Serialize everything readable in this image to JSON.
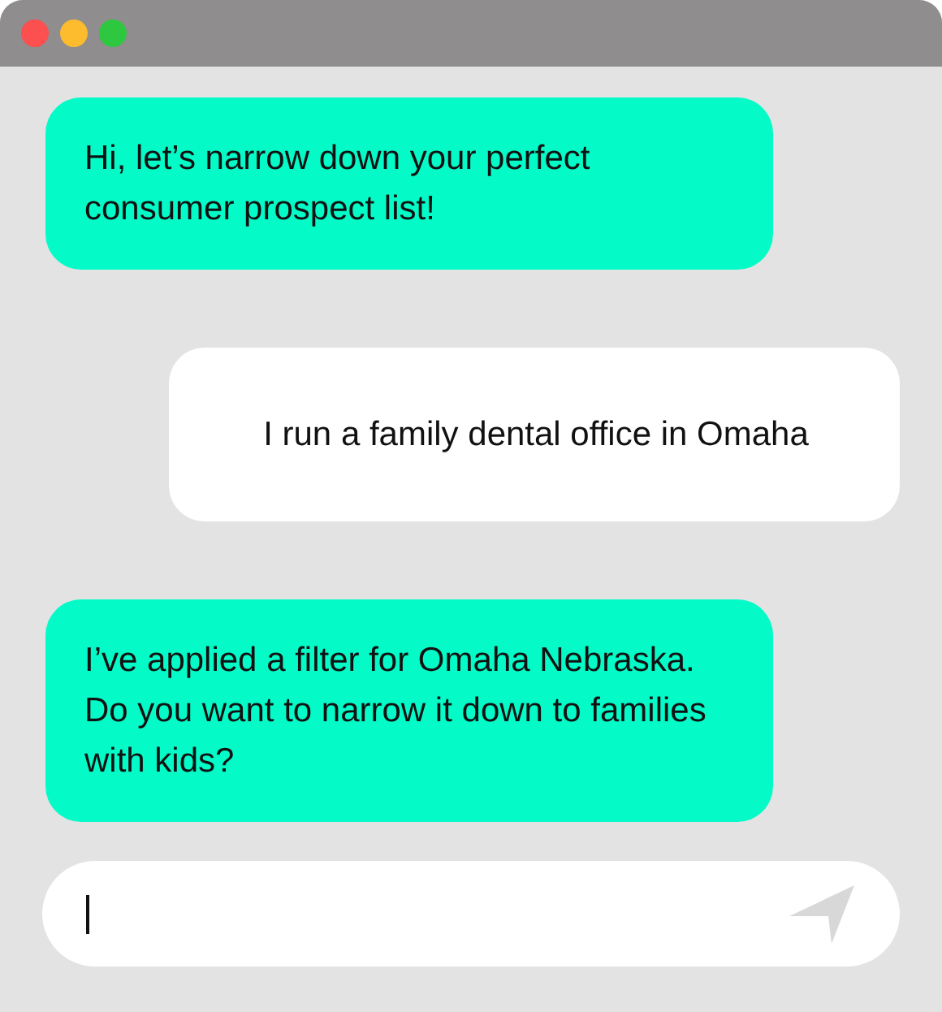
{
  "window": {
    "controls": [
      {
        "color": "#fc4f4f"
      },
      {
        "color": "#fdbb2e"
      },
      {
        "color": "#2ec840"
      }
    ]
  },
  "messages": [
    {
      "kind": "bot",
      "text": "Hi, let’s narrow down your perfect consumer prospect list!"
    },
    {
      "kind": "user",
      "text": "I run a family dental office in Omaha"
    },
    {
      "kind": "bot",
      "text": "I’ve applied a filter for Omaha Nebraska. Do you want to narrow it down to families with kids?"
    }
  ],
  "composer": {
    "focused": true
  }
}
